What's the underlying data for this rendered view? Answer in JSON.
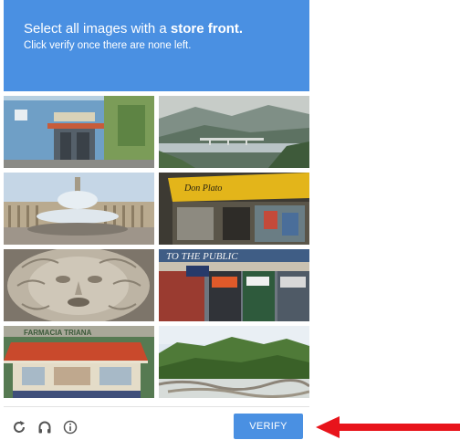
{
  "header": {
    "title_prefix": "Select all images with a ",
    "title_bold": "store front.",
    "subtitle": "Click verify once there are none left.",
    "background_color": "#4a90e2"
  },
  "tiles": [
    {
      "subject": "blue building with awning",
      "sign_text": ""
    },
    {
      "subject": "river valley with bridge",
      "sign_text": ""
    },
    {
      "subject": "fountain in plaza with colonnade",
      "sign_text": ""
    },
    {
      "subject": "shop with yellow awning",
      "sign_text": "Don Plato"
    },
    {
      "subject": "stone carved face relief",
      "sign_text": ""
    },
    {
      "subject": "row of storefronts",
      "sign_text": "TO THE PUBLIC"
    },
    {
      "subject": "pharmacy with red awning",
      "sign_text": "FARMACIA TRIANA"
    },
    {
      "subject": "river rapids with green hills",
      "sign_text": ""
    }
  ],
  "footer": {
    "reload_icon": "reload-icon",
    "audio_icon": "headphones-icon",
    "info_icon": "info-icon",
    "verify_label": "VERIFY"
  },
  "colors": {
    "accent": "#4a90e2",
    "arrow": "#e8141b"
  }
}
